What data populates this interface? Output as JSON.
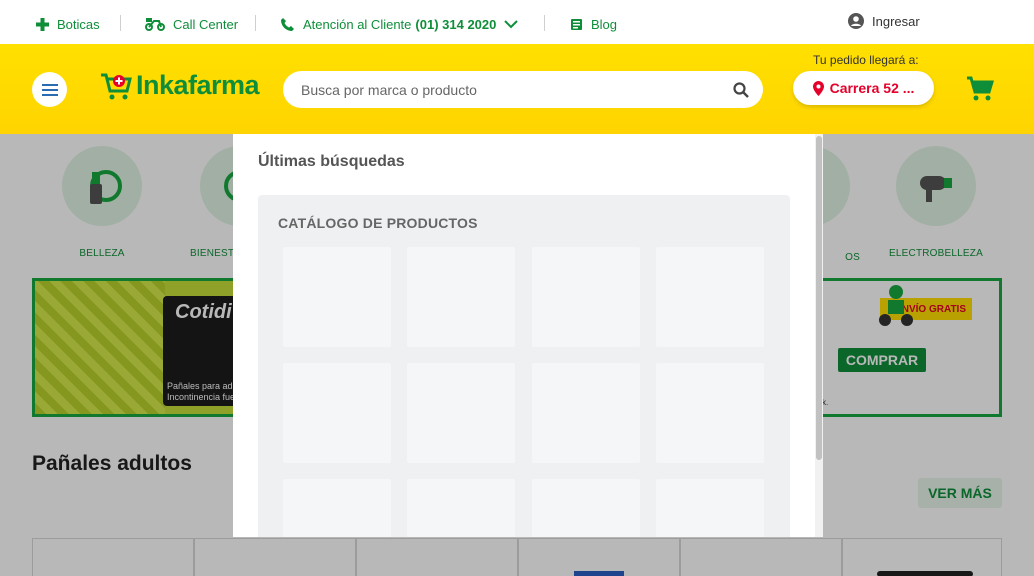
{
  "topbar": {
    "boticas": "Boticas",
    "call_center": "Call Center",
    "atencion_label": "Atención al Cliente",
    "atencion_phone": "(01) 314 2020",
    "blog": "Blog",
    "login": "Ingresar"
  },
  "header": {
    "logo_text": "Inkafarma",
    "search_placeholder": "Busca por marca o producto",
    "delivery_label": "Tu pedido llegará a:",
    "delivery_address": "Carrera 52 ..."
  },
  "categories": [
    {
      "label": "BELLEZA"
    },
    {
      "label": "BIENEST"
    },
    {
      "label": "OS"
    },
    {
      "label": "ELECTROBELLEZA"
    }
  ],
  "banner": {
    "brand": "Cotidi",
    "subtitle_line1": "Pañales para adult",
    "subtitle_line2": "Incontinencia fue",
    "envio": "ENVÍO GRATIS",
    "comprar": "COMPRAR",
    "note": "k."
  },
  "section": {
    "title": "Pañales adultos",
    "ver_mas": "VER MÁS"
  },
  "dropdown": {
    "recent_title": "Últimas búsquedas",
    "catalog_title": "CATÁLOGO DE PRODUCTOS"
  },
  "colors": {
    "brand_green": "#0f8e3a",
    "brand_yellow": "#ffe000",
    "accent_red": "#e4002b"
  }
}
